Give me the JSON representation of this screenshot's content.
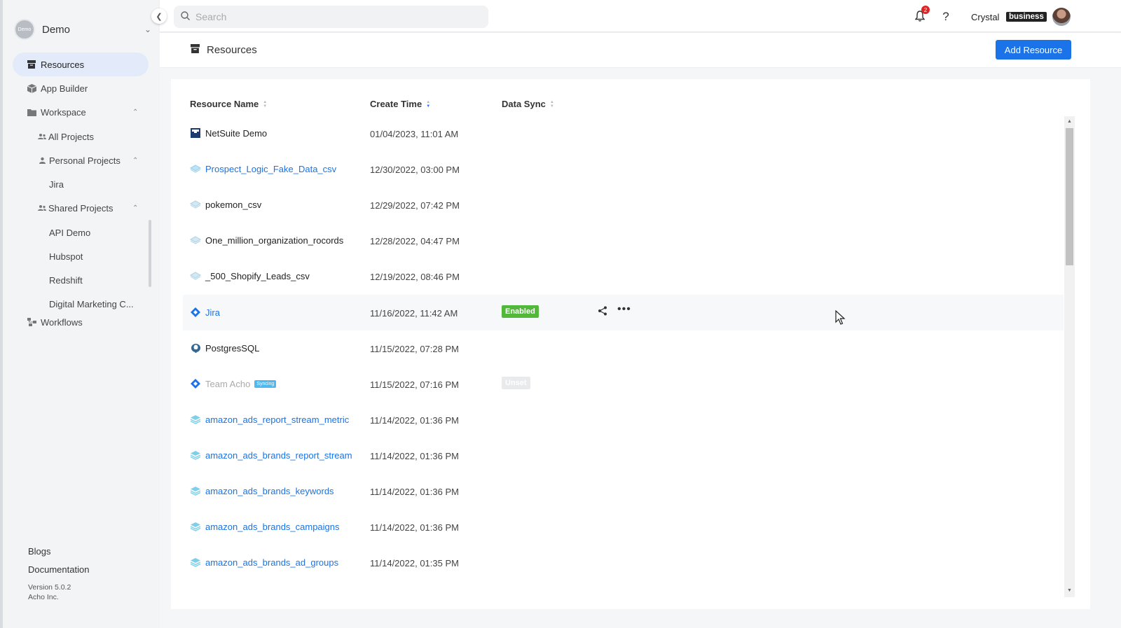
{
  "org": {
    "avatar_text": "Demo",
    "name": "Demo"
  },
  "sidebar": {
    "items": [
      {
        "label": "Resources"
      },
      {
        "label": "App Builder"
      },
      {
        "label": "Workspace"
      },
      {
        "label": "All Projects"
      },
      {
        "label": "Personal Projects"
      },
      {
        "label": "Jira"
      },
      {
        "label": "Shared Projects"
      },
      {
        "label": "API Demo"
      },
      {
        "label": "Hubspot"
      },
      {
        "label": "Redshift"
      },
      {
        "label": "Digital Marketing C..."
      },
      {
        "label": "Workflows"
      }
    ],
    "footer": {
      "blogs": "Blogs",
      "docs": "Documentation",
      "version": "Version 5.0.2",
      "company": "Acho Inc."
    }
  },
  "topbar": {
    "search_placeholder": "Search",
    "notification_count": "2",
    "help": "?",
    "user_name": "Crystal",
    "plan": "business"
  },
  "header": {
    "title": "Resources",
    "add_button": "Add Resource"
  },
  "table": {
    "columns": [
      "Resource Name",
      "Create Time",
      "Data Sync"
    ],
    "rows": [
      {
        "name": "NetSuite Demo",
        "time": "01/04/2023, 11:01 AM"
      },
      {
        "name": "Prospect_Logic_Fake_Data_csv",
        "time": "12/30/2022, 03:00 PM"
      },
      {
        "name": "pokemon_csv",
        "time": "12/29/2022, 07:42 PM"
      },
      {
        "name": "One_million_organization_rocords",
        "time": "12/28/2022, 04:47 PM"
      },
      {
        "name": "_500_Shopify_Leads_csv",
        "time": "12/19/2022, 08:46 PM"
      },
      {
        "name": "Jira",
        "time": "11/16/2022, 11:42 AM",
        "sync": "Enabled"
      },
      {
        "name": "PostgresSQL",
        "time": "11/15/2022, 07:28 PM"
      },
      {
        "name": "Team Acho",
        "time": "11/15/2022, 07:16 PM",
        "badge": "Syncing",
        "sync": "Unset"
      },
      {
        "name": "amazon_ads_report_stream_metric",
        "time": "11/14/2022, 01:36 PM"
      },
      {
        "name": "amazon_ads_brands_report_stream",
        "time": "11/14/2022, 01:36 PM"
      },
      {
        "name": "amazon_ads_brands_keywords",
        "time": "11/14/2022, 01:36 PM"
      },
      {
        "name": "amazon_ads_brands_campaigns",
        "time": "11/14/2022, 01:36 PM"
      },
      {
        "name": "amazon_ads_brands_ad_groups",
        "time": "11/14/2022, 01:35 PM"
      }
    ]
  },
  "colors": {
    "accent": "#1a73e8",
    "enabled": "#52b83a",
    "syncing": "#4fb8f0",
    "badge": "#e02424"
  }
}
